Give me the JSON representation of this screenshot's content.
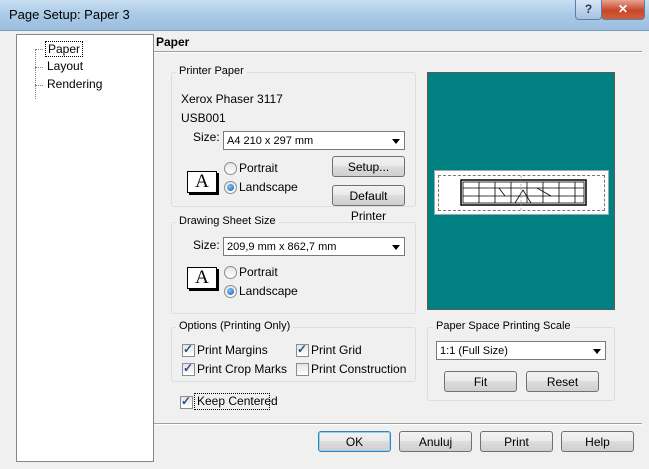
{
  "window": {
    "title": "Page Setup: Paper 3",
    "help_glyph": "?",
    "close_glyph": "✕"
  },
  "tree": {
    "items": [
      {
        "label": "Paper",
        "selected": true
      },
      {
        "label": "Layout",
        "selected": false
      },
      {
        "label": "Rendering",
        "selected": false
      }
    ]
  },
  "page": {
    "heading": "Paper"
  },
  "printer_paper": {
    "title": "Printer Paper",
    "printer_name": "Xerox Phaser 3117",
    "port": "USB001",
    "size_label": "Size:",
    "size_value": "A4 210 x 297 mm",
    "orientation_icon_glyph": "A",
    "portrait_label": "Portrait",
    "landscape_label": "Landscape",
    "orientation_selected": "Landscape",
    "setup_button": "Setup...",
    "default_printer_button": "Default Printer"
  },
  "drawing_sheet": {
    "title": "Drawing Sheet Size",
    "size_label": "Size:",
    "size_value": "209,9 mm x 862,7 mm",
    "orientation_icon_glyph": "A",
    "portrait_label": "Portrait",
    "landscape_label": "Landscape",
    "orientation_selected": "Landscape"
  },
  "options": {
    "title": "Options (Printing Only)",
    "print_margins": {
      "label": "Print Margins",
      "checked": true
    },
    "print_grid": {
      "label": "Print Grid",
      "checked": true
    },
    "print_crop_marks": {
      "label": "Print Crop Marks",
      "checked": true
    },
    "print_construction": {
      "label": "Print Construction",
      "checked": false
    }
  },
  "scale": {
    "title": "Paper Space Printing Scale",
    "value": "1:1 (Full Size)",
    "fit_button": "Fit",
    "reset_button": "Reset"
  },
  "keep_centered": {
    "label": "Keep Centered",
    "checked": true
  },
  "buttons": {
    "ok": "OK",
    "cancel": "Anuluj",
    "print": "Print",
    "help": "Help"
  },
  "colors": {
    "preview_background": "#008080",
    "default_button_border": "#3c7fb1"
  }
}
